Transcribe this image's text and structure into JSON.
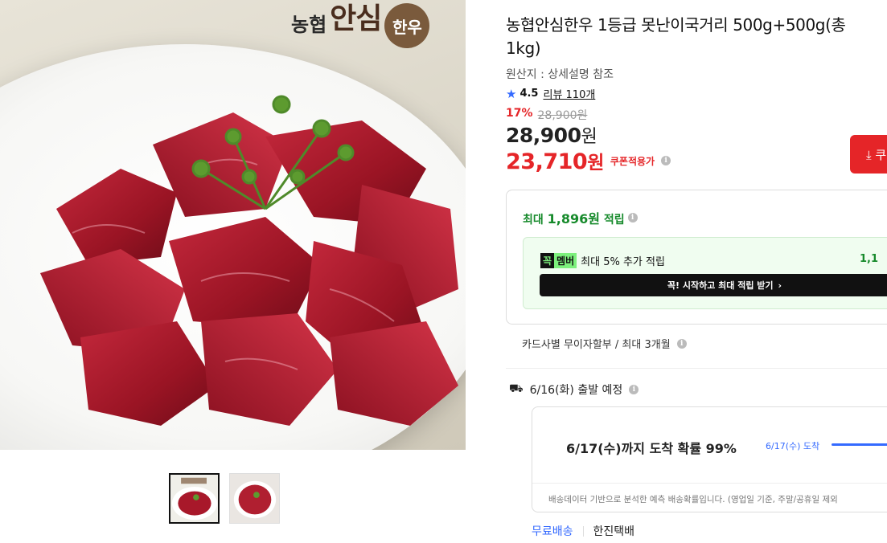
{
  "product": {
    "logo": {
      "brand": "농협",
      "big": "안심",
      "badge": "한우"
    },
    "title": "농협안심한우 1등급 못난이국거리 500g+500g(총 1kg)",
    "origin": "원산지 : 상세설명 참조",
    "rating": {
      "value": "4.5",
      "review_text": "리뷰 110개"
    },
    "pricing": {
      "discount_rate": "17%",
      "original_price": "28,900원",
      "sale_price_number": "28,900",
      "sale_price_unit": "원",
      "coupon_price_number": "23,710",
      "coupon_price_unit": "원",
      "coupon_label": "쿠폰적용가"
    },
    "download_button": "⤓ 쿠"
  },
  "reward": {
    "prefix": "최대",
    "amount": "1,896원",
    "suffix": "적립",
    "member": {
      "badge_left": "꼭",
      "badge_right": "멤버",
      "text": "최대 5% 추가 적립",
      "right_value": "1,1",
      "cta": "꼭! 시작하고 최대 적립 받기",
      "cta_arrow": "›"
    }
  },
  "installment": "카드사별 무이자할부 / 최대 3개월",
  "shipping": {
    "departure": "6/16(화) 출발 예정",
    "arrival_probability": "6/17(수)까지 도착 확률 99%",
    "arrival_mini": "6/17(수) 도착",
    "note": "배송데이터 기반으로 분석한 예측 배송확률입니다. (영업일 기준, 주말/공휴일 제외",
    "free_shipping": "무료배송",
    "carrier": "한진택배"
  },
  "icons": {
    "star": "★",
    "info": "i",
    "truck": "⛟"
  },
  "colors": {
    "accent_red": "#e52528",
    "accent_blue": "#346aff",
    "reward_green": "#168a2b"
  }
}
